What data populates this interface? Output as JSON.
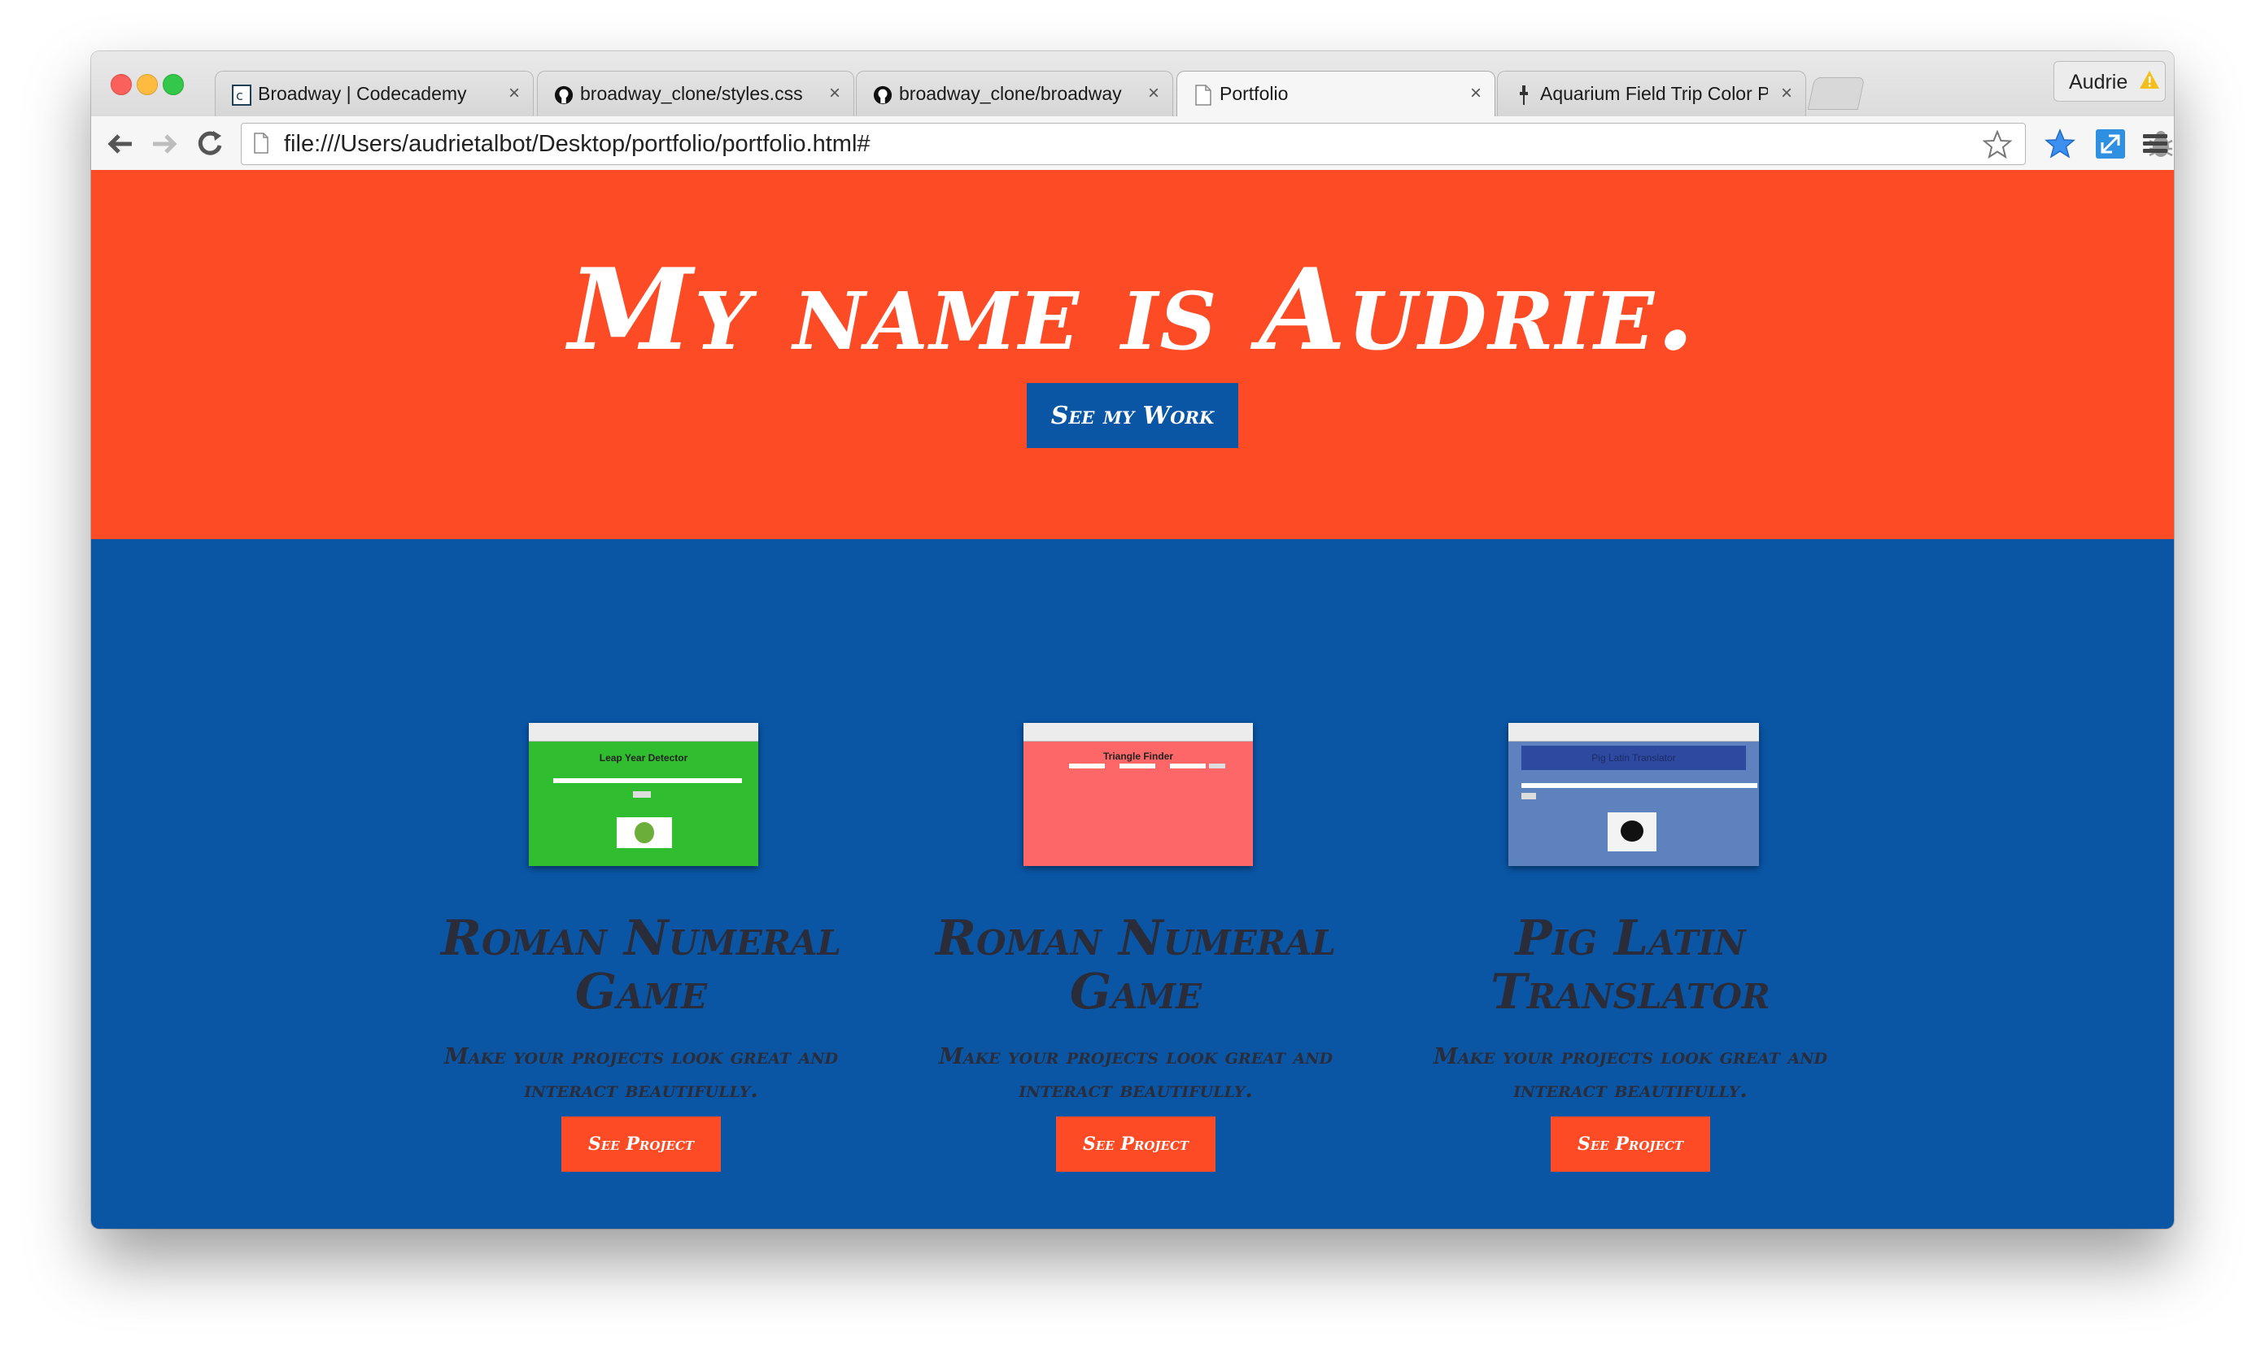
{
  "browser": {
    "tabs": [
      {
        "label": "Broadway | Codecademy",
        "icon": "codecademy-icon"
      },
      {
        "label": "broadway_clone/styles.css",
        "icon": "github-icon"
      },
      {
        "label": "broadway_clone/broadway",
        "icon": "github-icon"
      },
      {
        "label": "Portfolio",
        "icon": "page-icon",
        "active": true
      },
      {
        "label": "Aquarium Field Trip Color P",
        "icon": "pin-icon"
      }
    ],
    "close_glyph": "×",
    "profile_name": "Audrie",
    "profile_warning_icon": "warning-icon",
    "url": "file:///Users/audrietalbot/Desktop/portfolio/portfolio.html#",
    "extensions": [
      "star-icon",
      "extension-blue-icon",
      "resize-icon",
      "bug-icon",
      "menu-icon"
    ]
  },
  "hero": {
    "title": "My name is Audrie.",
    "button_label": "See my Work",
    "background": "#fd4b26"
  },
  "work": {
    "background": "#0a56a5",
    "projects": [
      {
        "title": "Roman Numeral Game",
        "description": "Make your projects look great and interact beautifully.",
        "button_label": "See Project",
        "thumbnail_title": "Leap Year Detector",
        "thumbnail_color": "#30bd2f"
      },
      {
        "title": "Roman Numeral Game",
        "description": "Make your projects look great and interact beautifully.",
        "button_label": "See Project",
        "thumbnail_title": "Triangle Finder",
        "thumbnail_color": "#fd6767"
      },
      {
        "title": "Pig Latin Translator",
        "description": "Make your projects look great and interact beautifully.",
        "button_label": "See Project",
        "thumbnail_title": "Pig Latin Translator",
        "thumbnail_color": "#5e82bd"
      }
    ]
  },
  "colors": {
    "accent_orange": "#fd4b26",
    "accent_blue": "#0a56a5",
    "heading_dark": "#2a2c3a"
  }
}
